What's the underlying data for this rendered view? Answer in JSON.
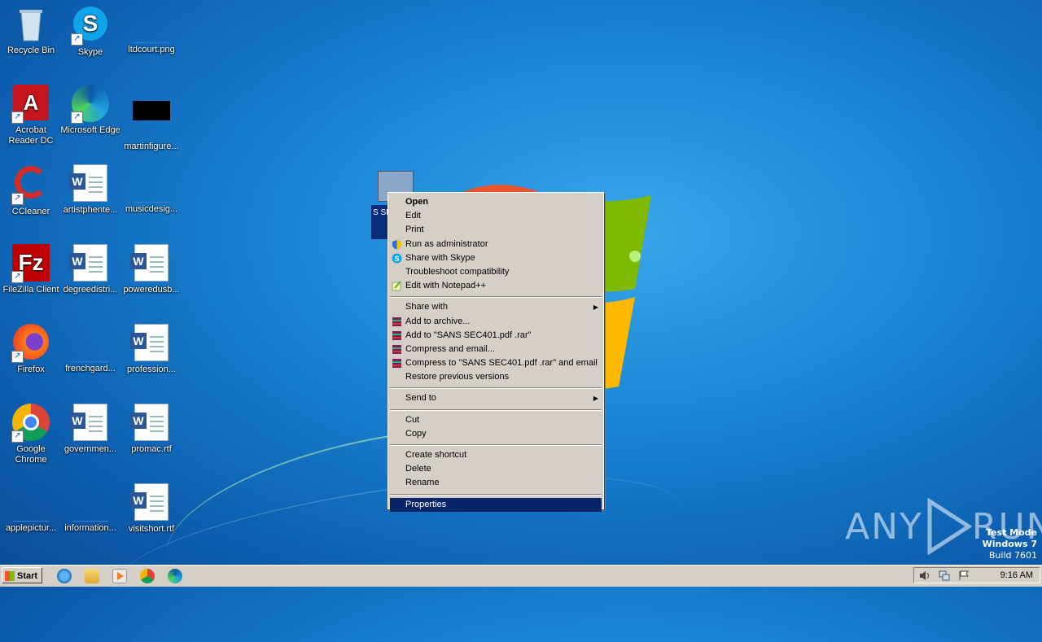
{
  "desktop": {
    "icons": [
      {
        "label": "Recycle Bin"
      },
      {
        "label": "Skype"
      },
      {
        "label": "ltdcourt.png"
      },
      {
        "label": "Acrobat Reader DC"
      },
      {
        "label": "Microsoft Edge"
      },
      {
        "label": "martinfigure..."
      },
      {
        "label": "CCleaner"
      },
      {
        "label": "artistphente..."
      },
      {
        "label": "musicdesig..."
      },
      {
        "label": "FileZilla Client"
      },
      {
        "label": "degreedistri..."
      },
      {
        "label": "poweredusb..."
      },
      {
        "label": "Firefox"
      },
      {
        "label": "frenchgard..."
      },
      {
        "label": "profession..."
      },
      {
        "label": "Google Chrome"
      },
      {
        "label": "governmen..."
      },
      {
        "label": "promac.rtf"
      },
      {
        "label": "applepictur..."
      },
      {
        "label": "information..."
      },
      {
        "label": "visitshort.rtf"
      }
    ],
    "selected_file_label": "S SEC"
  },
  "context_menu": {
    "items": [
      {
        "label": "Open"
      },
      {
        "label": "Edit"
      },
      {
        "label": "Print"
      },
      {
        "label": "Run as administrator"
      },
      {
        "label": "Share with Skype"
      },
      {
        "label": "Troubleshoot compatibility"
      },
      {
        "label": "Edit with Notepad++"
      },
      {
        "label": "Share with"
      },
      {
        "label": "Add to archive..."
      },
      {
        "label": "Add to \"SANS SEC401.pdf .rar\""
      },
      {
        "label": "Compress and email..."
      },
      {
        "label": "Compress to \"SANS SEC401.pdf .rar\" and email"
      },
      {
        "label": "Restore previous versions"
      },
      {
        "label": "Send to"
      },
      {
        "label": "Cut"
      },
      {
        "label": "Copy"
      },
      {
        "label": "Create shortcut"
      },
      {
        "label": "Delete"
      },
      {
        "label": "Rename"
      },
      {
        "label": "Properties"
      }
    ],
    "highlighted": "Properties"
  },
  "watermark": {
    "text_left": "ANY",
    "text_right": "RUN"
  },
  "os_info": {
    "line1": "Test Mode",
    "line2": "Windows 7",
    "line3": "Build 7601"
  },
  "taskbar": {
    "start_label": "Start",
    "clock": "9:16 AM"
  },
  "colors": {
    "menu_bg": "#d4d0c8",
    "menu_highlight": "#0a246a",
    "taskbar_bg": "#d4d0c8"
  }
}
